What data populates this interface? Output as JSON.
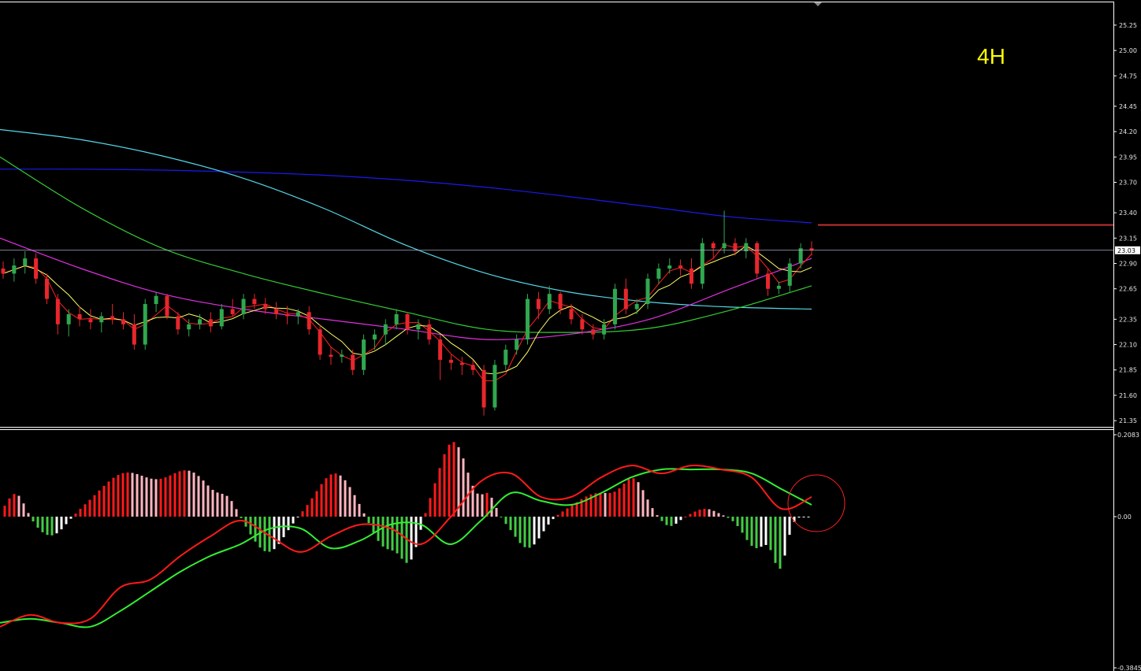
{
  "timeframe_label": "4H",
  "colors": {
    "background": "#000000",
    "axis": "#ffffff",
    "bull_candle": "#2fa84f",
    "bear_candle": "#e8262c",
    "ma_fast": "#ff2020",
    "ma_yellow": "#ffff66",
    "ma_magenta": "#e030e0",
    "ma_green": "#33cc33",
    "ma_cyan": "#55d8e8",
    "ma_blue": "#1a1aee",
    "hline": "#b0b0d0",
    "resistance": "#c0302f",
    "hist_pos_up": "#ff1a1a",
    "hist_pos_down": "#ffb6c1",
    "hist_neg_down": "#44cc44",
    "hist_neg_up": "#ffffff",
    "signal_red": "#ff1a1a",
    "signal_green": "#33ee33",
    "marker_circle": "#ff2020"
  },
  "chart_data": [
    {
      "type": "candlestick",
      "title": "",
      "price_ticks": [
        "25.25",
        "25.00",
        "24.75",
        "24.45",
        "24.20",
        "23.95",
        "23.70",
        "23.40",
        "23.15",
        "22.90",
        "22.65",
        "22.35",
        "22.10",
        "21.85",
        "21.60",
        "21.35"
      ],
      "ylim": [
        21.32,
        25.42
      ],
      "current_price": "23.03",
      "resistance_level": 23.28,
      "candles_ohlc": [
        [
          22.85,
          22.92,
          22.75,
          22.8
        ],
        [
          22.8,
          22.95,
          22.72,
          22.88
        ],
        [
          22.88,
          23.02,
          22.8,
          22.95
        ],
        [
          22.95,
          23.0,
          22.7,
          22.75
        ],
        [
          22.75,
          22.8,
          22.5,
          22.55
        ],
        [
          22.55,
          22.6,
          22.2,
          22.3
        ],
        [
          22.3,
          22.45,
          22.18,
          22.4
        ],
        [
          22.4,
          22.48,
          22.28,
          22.35
        ],
        [
          22.35,
          22.45,
          22.25,
          22.32
        ],
        [
          22.32,
          22.42,
          22.22,
          22.38
        ],
        [
          22.38,
          22.5,
          22.3,
          22.35
        ],
        [
          22.35,
          22.42,
          22.25,
          22.3
        ],
        [
          22.3,
          22.4,
          22.05,
          22.1
        ],
        [
          22.1,
          22.55,
          22.05,
          22.5
        ],
        [
          22.5,
          22.62,
          22.42,
          22.58
        ],
        [
          22.58,
          22.6,
          22.35,
          22.38
        ],
        [
          22.38,
          22.42,
          22.2,
          22.25
        ],
        [
          22.25,
          22.35,
          22.18,
          22.3
        ],
        [
          22.3,
          22.4,
          22.25,
          22.35
        ],
        [
          22.35,
          22.42,
          22.22,
          22.28
        ],
        [
          22.28,
          22.5,
          22.25,
          22.45
        ],
        [
          22.45,
          22.55,
          22.38,
          22.4
        ],
        [
          22.4,
          22.6,
          22.35,
          22.55
        ],
        [
          22.55,
          22.6,
          22.45,
          22.5
        ],
        [
          22.5,
          22.56,
          22.4,
          22.45
        ],
        [
          22.45,
          22.52,
          22.35,
          22.4
        ],
        [
          22.4,
          22.48,
          22.3,
          22.38
        ],
        [
          22.38,
          22.45,
          22.3,
          22.42
        ],
        [
          22.42,
          22.48,
          22.2,
          22.25
        ],
        [
          22.25,
          22.3,
          21.95,
          22.0
        ],
        [
          22.0,
          22.08,
          21.9,
          21.98
        ],
        [
          21.98,
          22.05,
          21.92,
          22.0
        ],
        [
          22.0,
          22.05,
          21.8,
          21.85
        ],
        [
          21.85,
          22.2,
          21.8,
          22.15
        ],
        [
          22.15,
          22.25,
          22.05,
          22.2
        ],
        [
          22.2,
          22.35,
          22.1,
          22.3
        ],
        [
          22.3,
          22.45,
          22.25,
          22.4
        ],
        [
          22.4,
          22.42,
          22.2,
          22.25
        ],
        [
          22.25,
          22.35,
          22.15,
          22.3
        ],
        [
          22.3,
          22.35,
          22.1,
          22.15
        ],
        [
          22.15,
          22.2,
          21.75,
          21.95
        ],
        [
          21.95,
          22.0,
          21.85,
          21.92
        ],
        [
          21.92,
          21.98,
          21.8,
          21.9
        ],
        [
          21.9,
          21.95,
          21.8,
          21.85
        ],
        [
          21.85,
          21.9,
          21.4,
          21.48
        ],
        [
          21.48,
          21.95,
          21.45,
          21.9
        ],
        [
          21.9,
          22.1,
          21.85,
          22.05
        ],
        [
          22.05,
          22.2,
          22.0,
          22.15
        ],
        [
          22.15,
          22.6,
          22.1,
          22.55
        ],
        [
          22.55,
          22.62,
          22.35,
          22.45
        ],
        [
          22.45,
          22.68,
          22.4,
          22.6
        ],
        [
          22.6,
          22.62,
          22.4,
          22.45
        ],
        [
          22.45,
          22.5,
          22.3,
          22.35
        ],
        [
          22.35,
          22.4,
          22.2,
          22.25
        ],
        [
          22.25,
          22.3,
          22.15,
          22.2
        ],
        [
          22.2,
          22.35,
          22.15,
          22.3
        ],
        [
          22.3,
          22.7,
          22.25,
          22.65
        ],
        [
          22.65,
          22.75,
          22.4,
          22.45
        ],
        [
          22.45,
          22.55,
          22.4,
          22.5
        ],
        [
          22.5,
          22.8,
          22.45,
          22.75
        ],
        [
          22.75,
          22.9,
          22.7,
          22.85
        ],
        [
          22.85,
          22.95,
          22.8,
          22.88
        ],
        [
          22.88,
          22.94,
          22.78,
          22.85
        ],
        [
          22.85,
          22.95,
          22.65,
          22.7
        ],
        [
          22.7,
          23.15,
          22.65,
          23.1
        ],
        [
          23.1,
          23.12,
          22.95,
          23.05
        ],
        [
          23.05,
          23.42,
          23.0,
          23.1
        ],
        [
          23.1,
          23.15,
          22.98,
          23.02
        ],
        [
          23.02,
          23.15,
          22.95,
          23.1
        ],
        [
          23.1,
          23.12,
          22.75,
          22.8
        ],
        [
          22.8,
          22.85,
          22.58,
          22.65
        ],
        [
          22.65,
          22.72,
          22.6,
          22.68
        ],
        [
          22.68,
          22.95,
          22.62,
          22.9
        ],
        [
          22.9,
          23.1,
          22.85,
          23.05
        ],
        [
          23.05,
          23.12,
          22.98,
          23.03
        ]
      ],
      "moving_averages": [
        {
          "name": "",
          "color_key": "ma_blue",
          "values": [
            23.83,
            23.83,
            23.82,
            23.8,
            23.77,
            23.72,
            23.65,
            23.56,
            23.46,
            23.36,
            23.3
          ]
        },
        {
          "name": "",
          "color_key": "ma_cyan",
          "values": [
            24.22,
            24.12,
            23.96,
            23.74,
            23.44,
            23.08,
            22.8,
            22.62,
            22.52,
            22.47,
            22.45
          ]
        },
        {
          "name": "",
          "color_key": "ma_green",
          "values": [
            23.95,
            23.45,
            23.05,
            22.8,
            22.6,
            22.42,
            22.25,
            22.22,
            22.26,
            22.44,
            22.68
          ]
        },
        {
          "name": "",
          "color_key": "ma_magenta",
          "values": [
            23.15,
            22.85,
            22.6,
            22.45,
            22.35,
            22.25,
            22.15,
            22.2,
            22.35,
            22.65,
            22.95
          ]
        }
      ]
    },
    {
      "type": "histogram+lines",
      "title": "",
      "ticks": [
        "0.2083",
        "0.00",
        "-0.3845"
      ],
      "ylim": [
        -0.3845,
        0.2083
      ]
    }
  ]
}
